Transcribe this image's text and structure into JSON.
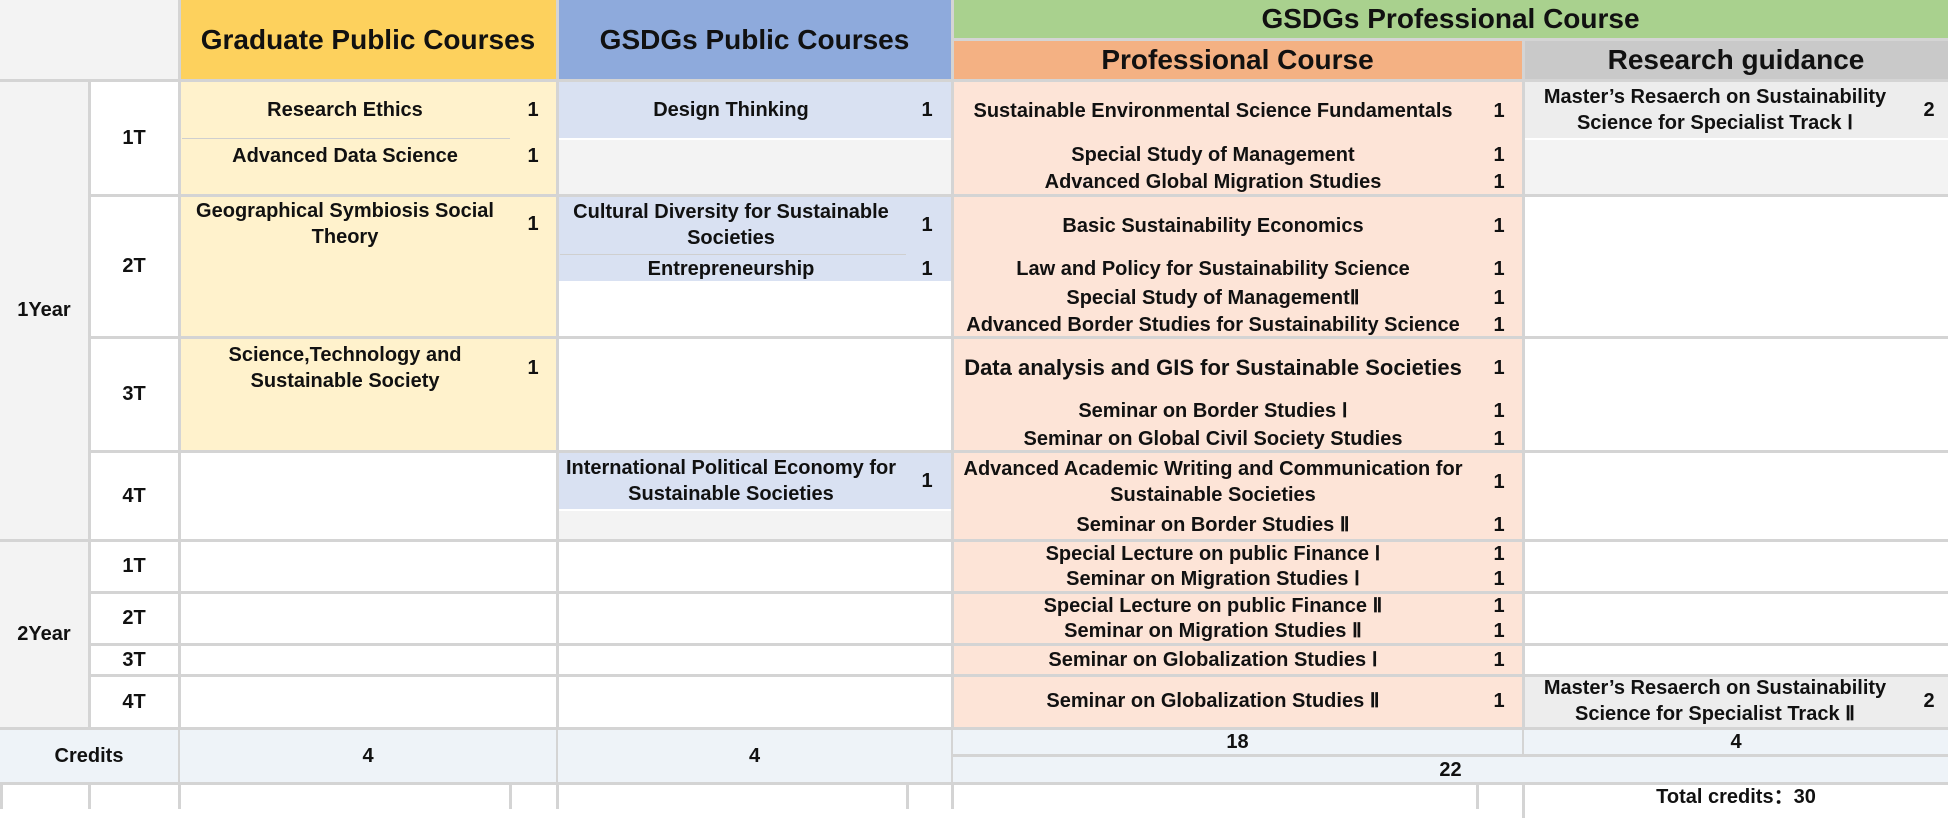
{
  "colors": {
    "graduate_header": "#fdd15d",
    "graduate_fill": "#fff2cc",
    "gsdgs_public_header": "#8eaadc",
    "gsdgs_public_fill": "#d9e1f2",
    "professional_group_header": "#a9d18e",
    "professional_header": "#f4b183",
    "professional_fill": "#fde4d7",
    "research_header": "#c9c9c9",
    "research_fill": "#ededed",
    "year_fill": "#f3f3f3",
    "credits_fill": "#eef3f8",
    "grid_line": "#d4d4d4"
  },
  "headers": {
    "graduate_public": "Graduate Public Courses",
    "gsdgs_public": "GSDGs Public Courses",
    "gsdgs_professional": "GSDGs Professional Course",
    "professional": "Professional Course",
    "research_guidance": "Research guidance"
  },
  "years": {
    "y1": "1Year",
    "y2": "2Year"
  },
  "terms": {
    "t1": "1T",
    "t2": "2T",
    "t3": "3T",
    "t4": "4T"
  },
  "graduate_courses": [
    {
      "name": "Research Ethics",
      "credit": "1"
    },
    {
      "name": "Advanced Data Science",
      "credit": "1"
    },
    {
      "name": "Geographical Symbiosis Social Theory",
      "credit": "1"
    },
    {
      "name": "Science,Technology and Sustainable Society",
      "credit": "1"
    }
  ],
  "gsdgs_public_courses": [
    {
      "name": "Design Thinking",
      "credit": "1"
    },
    {
      "name": "Cultural Diversity for Sustainable Societies",
      "credit": "1"
    },
    {
      "name": "Entrepreneurship",
      "credit": "1"
    },
    {
      "name": "International Political Economy for Sustainable Societies",
      "credit": "1"
    }
  ],
  "professional_courses": [
    {
      "name": "Sustainable Environmental Science Fundamentals",
      "credit": "1"
    },
    {
      "name": "Special Study of Management",
      "credit": "1"
    },
    {
      "name": "Advanced Global Migration Studies",
      "credit": "1"
    },
    {
      "name": "Basic Sustainability Economics",
      "credit": "1"
    },
    {
      "name": "Law and Policy for Sustainability Science",
      "credit": "1"
    },
    {
      "name": "Special Study of ManagementⅡ",
      "credit": "1"
    },
    {
      "name": "Advanced Border Studies for Sustainability Science",
      "credit": "1"
    },
    {
      "name": "Data analysis and GIS for Sustainable Societies",
      "credit": "1"
    },
    {
      "name": "Seminar on Border Studies Ⅰ",
      "credit": "1"
    },
    {
      "name": "Seminar on Global Civil Society Studies",
      "credit": "1"
    },
    {
      "name": "Advanced Academic Writing and Communication for Sustainable Societies",
      "credit": "1"
    },
    {
      "name": "Seminar on Border Studies Ⅱ",
      "credit": "1"
    },
    {
      "name": "Special Lecture on public Finance Ⅰ",
      "credit": "1"
    },
    {
      "name": "Seminar on Migration Studies Ⅰ",
      "credit": "1"
    },
    {
      "name": "Special Lecture on public Finance Ⅱ",
      "credit": "1"
    },
    {
      "name": "Seminar on Migration Studies Ⅱ",
      "credit": "1"
    },
    {
      "name": "Seminar on Globalization Studies Ⅰ",
      "credit": "1"
    },
    {
      "name": "Seminar on Globalization Studies Ⅱ",
      "credit": "1"
    }
  ],
  "research_courses": [
    {
      "name": "Master’s Resaerch on Sustainability Science for Specialist Track Ⅰ",
      "credit": "2"
    },
    {
      "name": "Master’s Resaerch on Sustainability Science for Specialist Track Ⅱ",
      "credit": "2"
    }
  ],
  "credits": {
    "label": "Credits",
    "graduate": "4",
    "gsdgs_public": "4",
    "professional": "18",
    "research": "4",
    "gsdgs_professional_total": "22",
    "total": "Total credits：30"
  }
}
